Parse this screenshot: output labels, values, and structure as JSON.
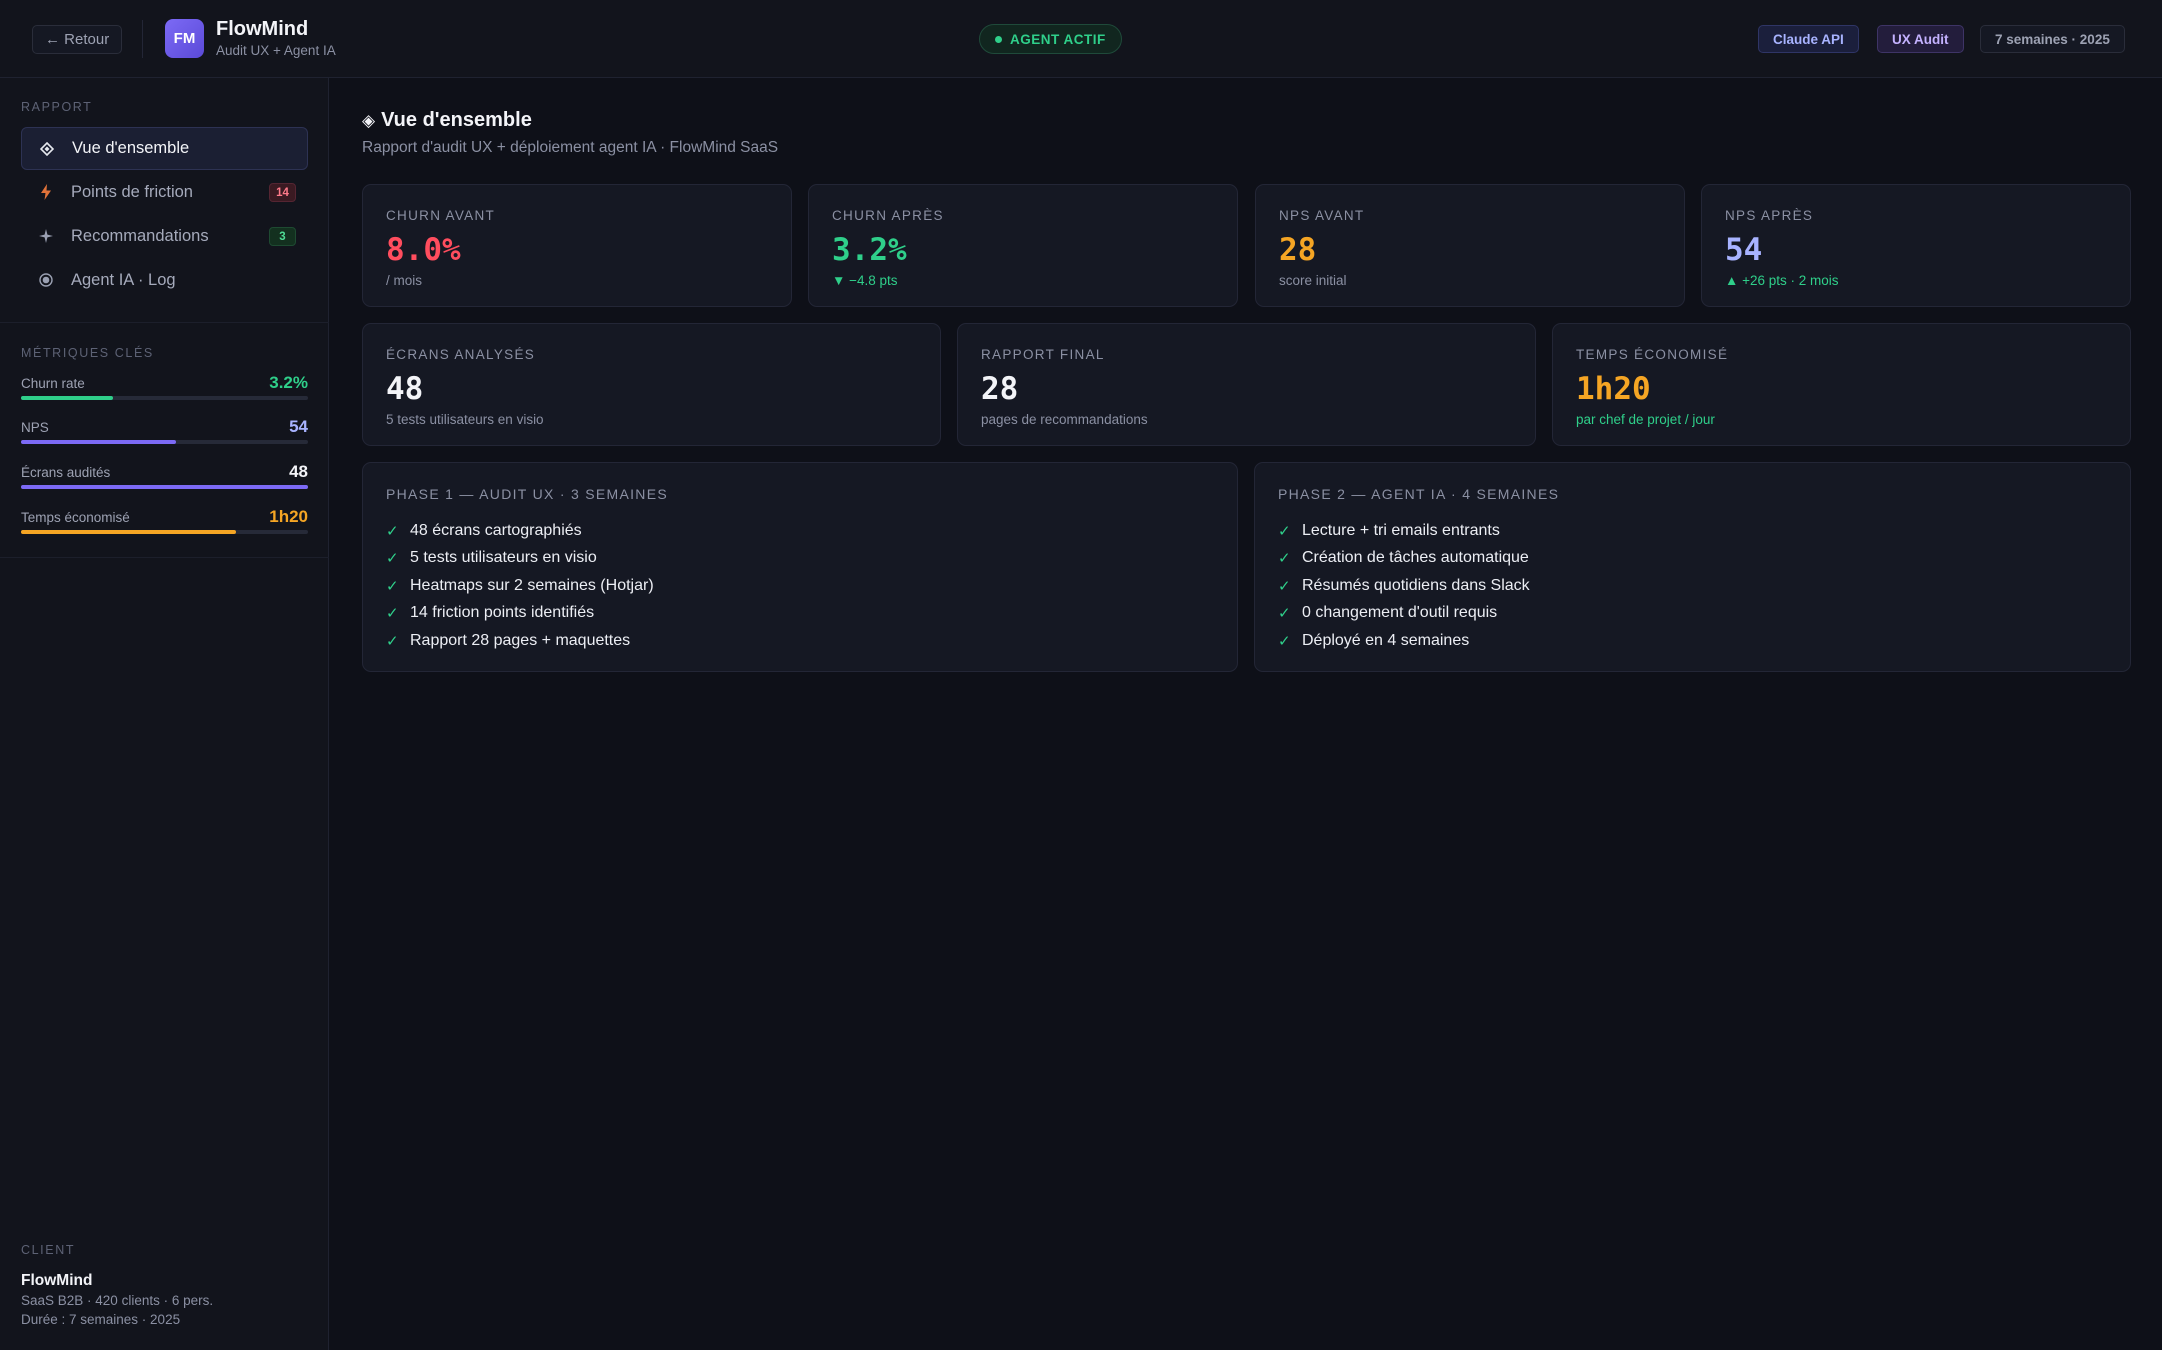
{
  "header": {
    "back_label": "← Retour",
    "logo_initials": "FM",
    "brand_name": "FlowMind",
    "brand_sub": "Audit UX + Agent IA",
    "status_label": "AGENT ACTIF",
    "pills": [
      "Claude API",
      "UX Audit",
      "7 semaines · 2025"
    ]
  },
  "sidebar": {
    "section_label": "RAPPORT",
    "nav": [
      {
        "label": "Vue d'ensemble",
        "icon": "diamond-icon",
        "badge": ""
      },
      {
        "label": "Points de friction",
        "icon": "lightning-icon",
        "badge": "14"
      },
      {
        "label": "Recommandations",
        "icon": "sparkle-icon",
        "badge": "3"
      },
      {
        "label": "Agent IA · Log",
        "icon": "radio-dot-icon",
        "badge": ""
      }
    ],
    "metrics_label": "MÉTRIQUES CLÉS",
    "metrics": [
      {
        "label": "Churn rate",
        "value": "3.2%",
        "fill": 0.32,
        "color": "#2fcf8a"
      },
      {
        "label": "NPS",
        "value": "54",
        "fill": 0.54,
        "color": "#7c6af5"
      },
      {
        "label": "Écrans audités",
        "value": "48",
        "fill": 1.0,
        "color": "#7c6af5"
      },
      {
        "label": "Temps économisé",
        "value": "1h20",
        "fill": 0.75,
        "color": "#f5a524"
      }
    ],
    "client": {
      "label": "CLIENT",
      "name": "FlowMind",
      "line1": "SaaS B2B · 420 clients · 6 pers.",
      "line2": "Durée : 7 semaines · 2025"
    }
  },
  "main": {
    "title_icon": "◈",
    "title": "Vue d'ensemble",
    "subtitle": "Rapport d'audit UX + déploiement agent IA · FlowMind SaaS",
    "kpis": [
      {
        "label": "CHURN AVANT",
        "value": "8.0%",
        "note": "/ mois",
        "color": "#ff4d5e",
        "note_color": "#8b90a3"
      },
      {
        "label": "CHURN APRÈS",
        "value": "3.2%",
        "note": "▼ −4.8 pts",
        "color": "#2fcf8a",
        "note_color": "#2fcf8a"
      },
      {
        "label": "NPS AVANT",
        "value": "28",
        "note": "score initial",
        "color": "#f5a524",
        "note_color": "#8b90a3"
      },
      {
        "label": "NPS APRÈS",
        "value": "54",
        "note": "▲ +26 pts · 2 mois",
        "color": "#a8b3ff",
        "note_color": "#2fcf8a"
      }
    ],
    "stats": [
      {
        "label": "ÉCRANS ANALYSÉS",
        "value": "48",
        "note": "5 tests utilisateurs en visio",
        "color": "#f3f4f8",
        "note_color": "#8b90a3"
      },
      {
        "label": "RAPPORT FINAL",
        "value": "28",
        "note": "pages de recommandations",
        "color": "#f3f4f8",
        "note_color": "#8b90a3"
      },
      {
        "label": "TEMPS ÉCONOMISÉ",
        "value": "1h20",
        "note": "par chef de projet / jour",
        "color": "#f5a524",
        "note_color": "#2fcf8a"
      }
    ],
    "phases": [
      {
        "title": "PHASE 1 — AUDIT UX · 3 SEMAINES",
        "items": [
          "48 écrans cartographiés",
          "5 tests utilisateurs en visio",
          "Heatmaps sur 2 semaines (Hotjar)",
          "14 friction points identifiés",
          "Rapport 28 pages + maquettes"
        ]
      },
      {
        "title": "PHASE 2 — AGENT IA · 4 SEMAINES",
        "items": [
          "Lecture + tri emails entrants",
          "Création de tâches automatique",
          "Résumés quotidiens dans Slack",
          "0 changement d'outil requis",
          "Déployé en 4 semaines"
        ]
      }
    ],
    "check_glyph": "✓"
  }
}
